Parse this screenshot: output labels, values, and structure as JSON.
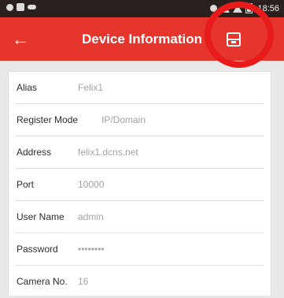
{
  "status_bar": {
    "time": "18:56"
  },
  "header": {
    "title": "Device Information",
    "back_icon": "arrow-left-icon",
    "save_icon": "floppy-disk-icon"
  },
  "fields": [
    {
      "label": "Alias",
      "value": "Felix1"
    },
    {
      "label": "Register Mode",
      "value": "IP/Domain"
    },
    {
      "label": "Address",
      "value": "felix1.dcns.net"
    },
    {
      "label": "Port",
      "value": "10000"
    },
    {
      "label": "User Name",
      "value": "admin"
    },
    {
      "label": "Password",
      "value": "••••••••"
    },
    {
      "label": "Camera No.",
      "value": "16"
    }
  ],
  "colors": {
    "app_bar": "#e5352c",
    "status_bar": "#2a211f",
    "highlight": "#e81a1a"
  }
}
